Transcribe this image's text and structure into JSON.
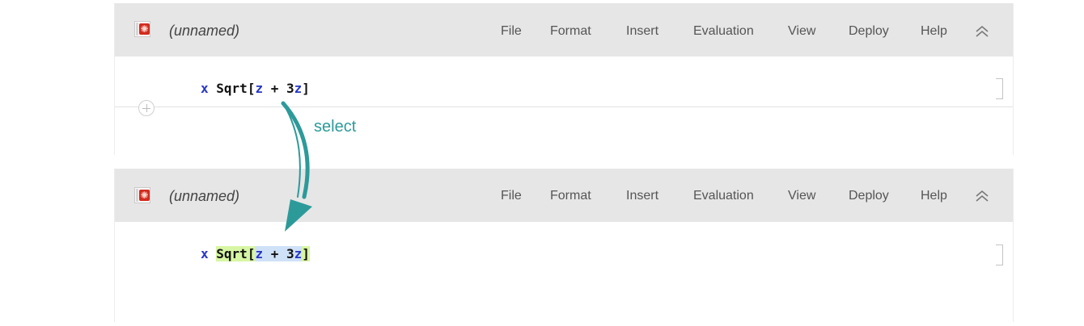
{
  "colors": {
    "toolbar_bg": "#e6e6e6",
    "variable_blue": "#2636c4",
    "highlight_function": "#d7f6a3",
    "highlight_argument": "#cfe1f7",
    "annotation_teal": "#2d9a9a",
    "notebook_icon_red": "#d22b1f"
  },
  "panels": [
    {
      "notebook_title": "(unnamed)",
      "menu": [
        "File",
        "Format",
        "Insert",
        "Evaluation",
        "View",
        "Deploy",
        "Help"
      ],
      "code": {
        "var_x": "x",
        "fn": "Sqrt",
        "open": "[",
        "z1": "z",
        "plus": "+",
        "num": "3",
        "z2": "z",
        "close": "]"
      }
    },
    {
      "notebook_title": "(unnamed)",
      "menu": [
        "File",
        "Format",
        "Insert",
        "Evaluation",
        "View",
        "Deploy",
        "Help"
      ],
      "code": {
        "var_x": "x",
        "fn": "Sqrt",
        "open": "[",
        "z1": "z",
        "plus": "+",
        "num": "3",
        "z2": "z",
        "close": "]"
      }
    }
  ],
  "annotation": {
    "label": "select"
  },
  "icons": {
    "notebook": "notebook-icon",
    "collapse": "double-chevron-up-icon",
    "add_cell": "add-cell-plus-icon",
    "arrow": "curved-arrow-icon"
  }
}
